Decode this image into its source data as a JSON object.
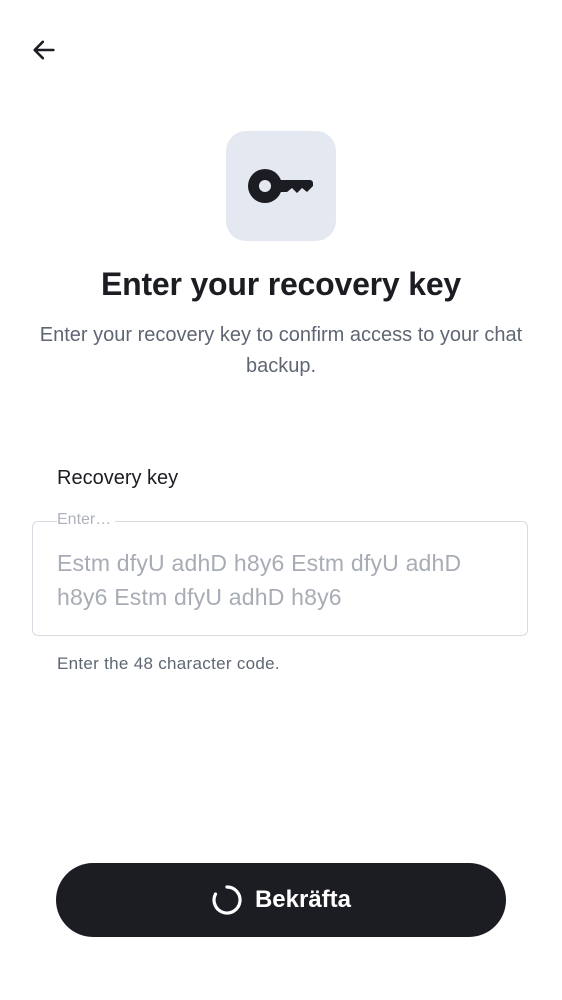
{
  "header": {
    "back_icon": "arrow-left-icon"
  },
  "hero": {
    "icon": "key-icon",
    "tile_color": "#e4e8f1"
  },
  "title": "Enter your recovery key",
  "subtitle": "Enter your recovery key to confirm access to your chat backup.",
  "recovery_field": {
    "label": "Recovery key",
    "placeholder": "Enter…",
    "value": "Estm dfyU adhD h8y6 Estm dfyU adhD h8y6 Estm dfyU adhD h8y6",
    "helper": "Enter the 48 character code."
  },
  "confirm_button": {
    "label": "Bekräfta",
    "state": "loading",
    "spinner_icon": "spinner-icon",
    "background": "#1b1d22"
  }
}
